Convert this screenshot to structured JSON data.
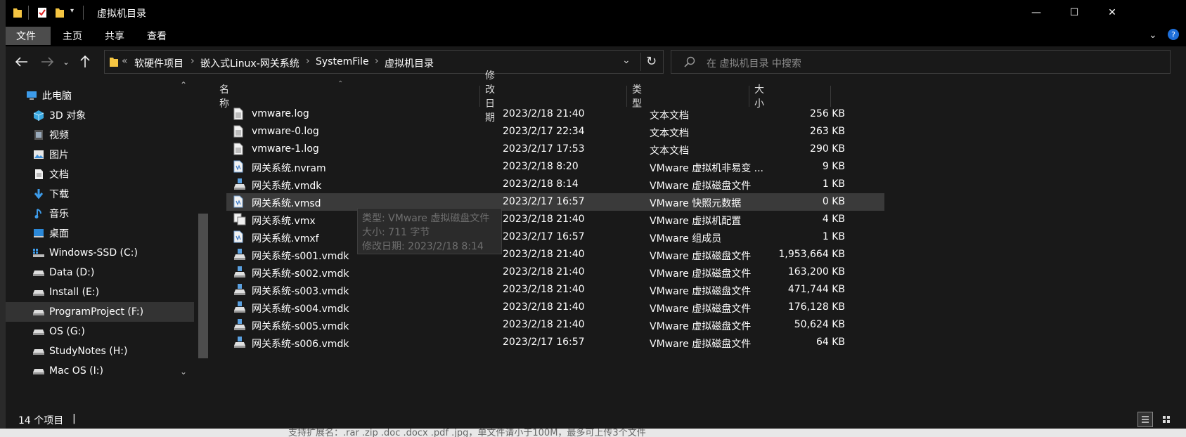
{
  "window": {
    "title": "虚拟机目录",
    "minimize_glyph": "—",
    "maximize_glyph": "☐",
    "close_glyph": "✕"
  },
  "ribbon": {
    "tabs": [
      {
        "label": "文件",
        "active": true
      },
      {
        "label": "主页",
        "active": false
      },
      {
        "label": "共享",
        "active": false
      },
      {
        "label": "查看",
        "active": false
      }
    ]
  },
  "address": {
    "overflow": "«",
    "crumbs": [
      "软硬件项目",
      "嵌入式Linux-网关系统",
      "SystemFile",
      "虚拟机目录"
    ],
    "search_placeholder": "在 虚拟机目录 中搜索"
  },
  "navpane": {
    "items": [
      {
        "label": "此电脑",
        "icon": "pc-icon",
        "indent": 1
      },
      {
        "label": "3D 对象",
        "icon": "cube-icon",
        "indent": 2
      },
      {
        "label": "视频",
        "icon": "video-icon",
        "indent": 2
      },
      {
        "label": "图片",
        "icon": "picture-icon",
        "indent": 2
      },
      {
        "label": "文档",
        "icon": "document-icon",
        "indent": 2
      },
      {
        "label": "下载",
        "icon": "download-icon",
        "indent": 2
      },
      {
        "label": "音乐",
        "icon": "music-icon",
        "indent": 2
      },
      {
        "label": "桌面",
        "icon": "desktop-icon",
        "indent": 2
      },
      {
        "label": "Windows-SSD (C:)",
        "icon": "system-drive-icon",
        "indent": 2
      },
      {
        "label": "Data (D:)",
        "icon": "drive-icon",
        "indent": 2
      },
      {
        "label": "Install (E:)",
        "icon": "drive-icon",
        "indent": 2
      },
      {
        "label": "ProgramProject (F:)",
        "icon": "drive-icon",
        "indent": 2,
        "selected": true
      },
      {
        "label": "OS (G:)",
        "icon": "drive-icon",
        "indent": 2
      },
      {
        "label": "StudyNotes (H:)",
        "icon": "drive-icon",
        "indent": 2
      },
      {
        "label": "Mac OS (I:)",
        "icon": "drive-icon",
        "indent": 2
      }
    ]
  },
  "columns": {
    "name": "名称",
    "modified": "修改日期",
    "type": "类型",
    "size": "大小"
  },
  "files": [
    {
      "name": "vmware.log",
      "modified": "2023/2/18 21:40",
      "type": "文本文档",
      "size": "256 KB",
      "icon": "text-file-icon"
    },
    {
      "name": "vmware-0.log",
      "modified": "2023/2/17 22:34",
      "type": "文本文档",
      "size": "263 KB",
      "icon": "text-file-icon"
    },
    {
      "name": "vmware-1.log",
      "modified": "2023/2/17 17:53",
      "type": "文本文档",
      "size": "290 KB",
      "icon": "text-file-icon"
    },
    {
      "name": "网关系统.nvram",
      "modified": "2023/2/18 8:20",
      "type": "VMware 虚拟机非易变 ...",
      "size": "9 KB",
      "icon": "vmware-doc-icon"
    },
    {
      "name": "网关系统.vmdk",
      "modified": "2023/2/18 8:14",
      "type": "VMware 虚拟磁盘文件",
      "size": "1 KB",
      "icon": "vmware-disk-icon"
    },
    {
      "name": "网关系统.vmsd",
      "modified": "2023/2/17 16:57",
      "type": "VMware 快照元数据",
      "size": "0 KB",
      "icon": "vmware-doc-icon",
      "selected": true
    },
    {
      "name": "网关系统.vmx",
      "modified": "2023/2/18 21:40",
      "type": "VMware 虚拟机配置",
      "size": "4 KB",
      "icon": "vmware-config-icon"
    },
    {
      "name": "网关系统.vmxf",
      "modified": "2023/2/17 16:57",
      "type": "VMware 组成员",
      "size": "1 KB",
      "icon": "vmware-doc-icon"
    },
    {
      "name": "网关系统-s001.vmdk",
      "modified": "2023/2/18 21:40",
      "type": "VMware 虚拟磁盘文件",
      "size": "1,953,664 KB",
      "icon": "vmware-disk-icon"
    },
    {
      "name": "网关系统-s002.vmdk",
      "modified": "2023/2/18 21:40",
      "type": "VMware 虚拟磁盘文件",
      "size": "163,200 KB",
      "icon": "vmware-disk-icon"
    },
    {
      "name": "网关系统-s003.vmdk",
      "modified": "2023/2/18 21:40",
      "type": "VMware 虚拟磁盘文件",
      "size": "471,744 KB",
      "icon": "vmware-disk-icon"
    },
    {
      "name": "网关系统-s004.vmdk",
      "modified": "2023/2/18 21:40",
      "type": "VMware 虚拟磁盘文件",
      "size": "176,128 KB",
      "icon": "vmware-disk-icon"
    },
    {
      "name": "网关系统-s005.vmdk",
      "modified": "2023/2/18 21:40",
      "type": "VMware 虚拟磁盘文件",
      "size": "50,624 KB",
      "icon": "vmware-disk-icon"
    },
    {
      "name": "网关系统-s006.vmdk",
      "modified": "2023/2/17 16:57",
      "type": "VMware 虚拟磁盘文件",
      "size": "64 KB",
      "icon": "vmware-disk-icon"
    }
  ],
  "tooltip": {
    "type_line": "类型: VMware 虚拟磁盘文件",
    "size_line": "大小: 711 字节",
    "date_line": "修改日期: 2023/2/18 8:14"
  },
  "status": {
    "count": "14 个项目",
    "separator": "|"
  },
  "background_page": {
    "text": "支持扩展名：.rar .zip .doc .docx .pdf .jpg，单文件请小于100M，最多可上传3个文件"
  },
  "colors": {
    "window_bg": "#191919",
    "titlebar_bg": "#000000",
    "active_tab_bg": "#4c4c4c",
    "selection_bg": "#3a3a3a",
    "folder_yellow": "#f5c542"
  }
}
